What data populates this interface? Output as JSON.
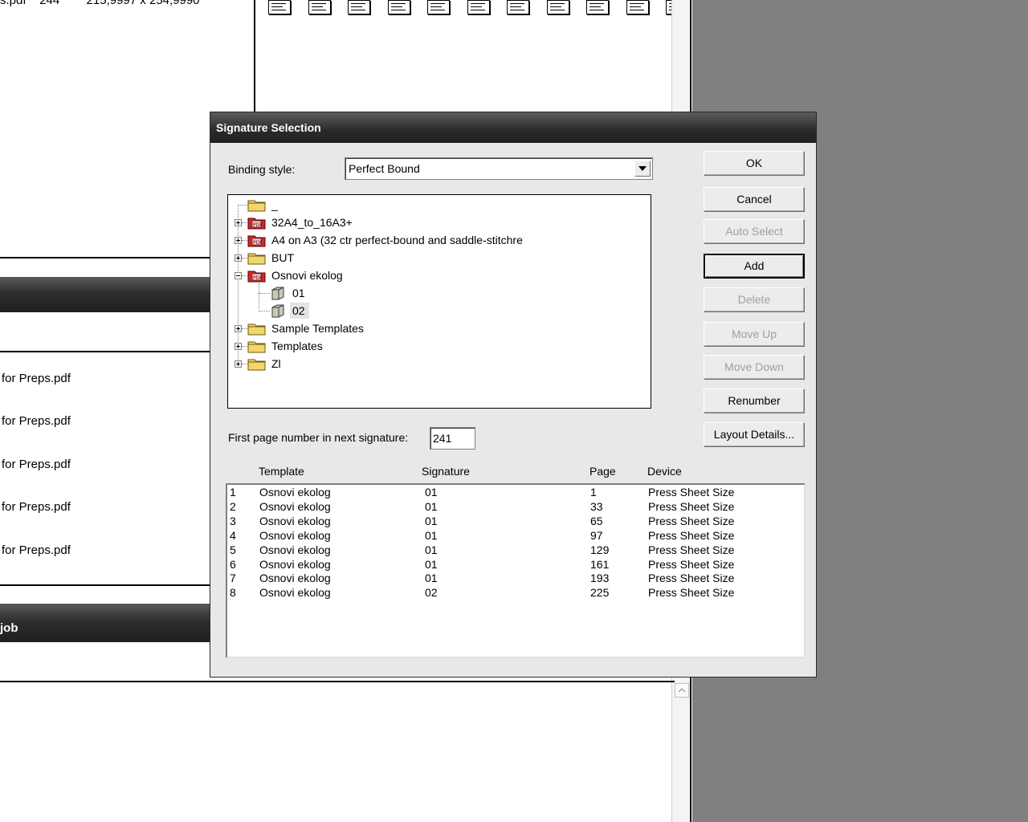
{
  "background": {
    "top_row_fragment": "s.pdf    244        215,9997 x 254,9990",
    "list_items": [
      "for Preps.pdf",
      "for Preps.pdf",
      "for Preps.pdf",
      "for Preps.pdf",
      "for Preps.pdf"
    ],
    "job_bar_label": "job"
  },
  "dialog": {
    "title": "Signature Selection",
    "binding_label": "Binding style:",
    "binding_value": "Perfect Bound",
    "tree": {
      "root_label": "_",
      "items": [
        {
          "label": "32A4_to_16A3+",
          "type": "pdf-folder",
          "expanded": false
        },
        {
          "label": "A4 on A3 (32 ctr perfect-bound and saddle-stitchre",
          "type": "pdf-folder",
          "expanded": false
        },
        {
          "label": "BUT",
          "type": "folder",
          "expanded": false
        },
        {
          "label": "Osnovi ekolog",
          "type": "pdf-folder",
          "expanded": true
        },
        {
          "label": "01",
          "type": "signature",
          "child": true
        },
        {
          "label": "02",
          "type": "signature",
          "child": true,
          "selected": true
        },
        {
          "label": "Sample Templates",
          "type": "folder",
          "expanded": false
        },
        {
          "label": "Templates",
          "type": "folder",
          "expanded": false
        },
        {
          "label": "Zl",
          "type": "folder",
          "expanded": false
        }
      ]
    },
    "first_page_label": "First page number in next signature:",
    "first_page_value": "241",
    "buttons": {
      "ok": "OK",
      "cancel": "Cancel",
      "auto_select": "Auto Select",
      "add": "Add",
      "delete": "Delete",
      "move_up": "Move Up",
      "move_down": "Move Down",
      "renumber": "Renumber",
      "layout_details": "Layout Details..."
    },
    "table": {
      "headers": {
        "template": "Template",
        "signature": "Signature",
        "page": "Page",
        "device": "Device"
      },
      "rows": [
        {
          "num": "1",
          "template": "Osnovi ekolog",
          "signature": "01",
          "page": "1",
          "device": "Press Sheet Size"
        },
        {
          "num": "2",
          "template": "Osnovi ekolog",
          "signature": "01",
          "page": "33",
          "device": "Press Sheet Size"
        },
        {
          "num": "3",
          "template": "Osnovi ekolog",
          "signature": "01",
          "page": "65",
          "device": "Press Sheet Size"
        },
        {
          "num": "4",
          "template": "Osnovi ekolog",
          "signature": "01",
          "page": "97",
          "device": "Press Sheet Size"
        },
        {
          "num": "5",
          "template": "Osnovi ekolog",
          "signature": "01",
          "page": "129",
          "device": "Press Sheet Size"
        },
        {
          "num": "6",
          "template": "Osnovi ekolog",
          "signature": "01",
          "page": "161",
          "device": "Press Sheet Size"
        },
        {
          "num": "7",
          "template": "Osnovi ekolog",
          "signature": "01",
          "page": "193",
          "device": "Press Sheet Size"
        },
        {
          "num": "8",
          "template": "Osnovi ekolog",
          "signature": "02",
          "page": "225",
          "device": "Press Sheet Size"
        }
      ]
    }
  },
  "colors": {
    "desktop_gray": "#808080",
    "dialog_face": "#e8e8e8",
    "titlebar_dark": "#2a2a2a",
    "pdf_red": "#cc2a2a",
    "folder_yellow": "#f2d66b"
  }
}
